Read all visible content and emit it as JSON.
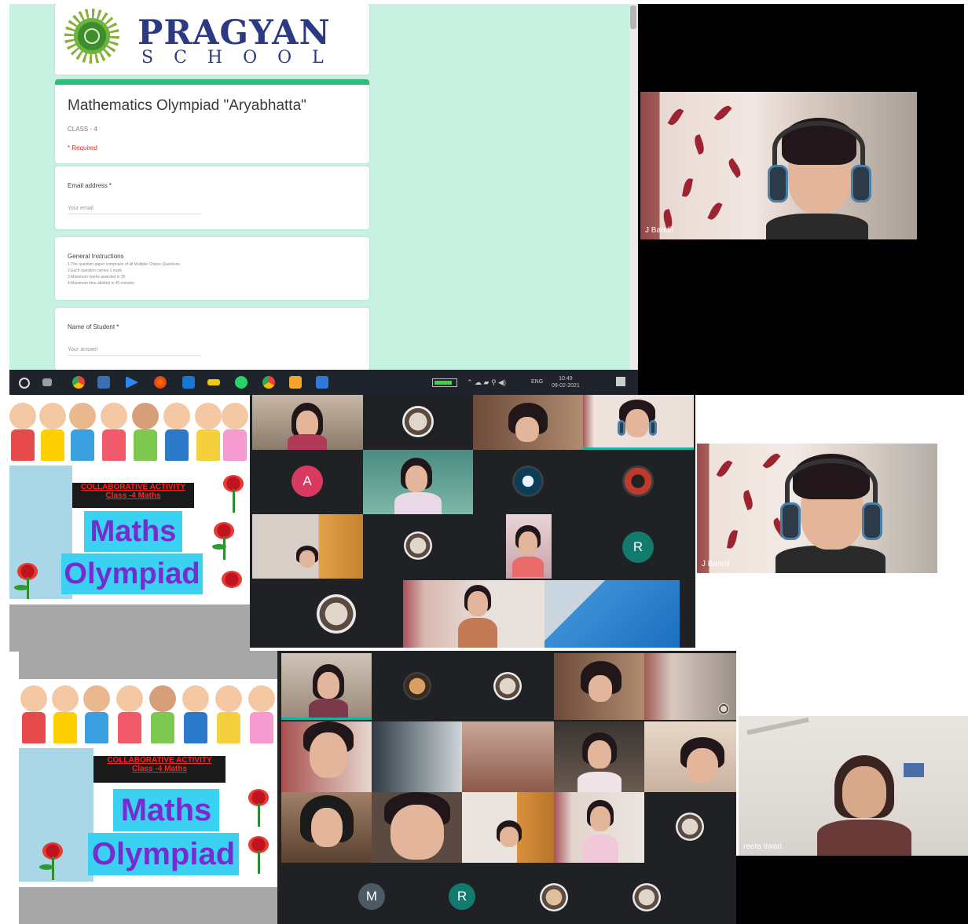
{
  "form": {
    "logo_main": "PRAGYAN",
    "logo_sub": "SCHOOL",
    "title": "Mathematics Olympiad \"Aryabhatta\"",
    "class_label": "CLASS - 4",
    "required_note": "* Required",
    "questions": [
      {
        "label": "Email address *",
        "placeholder": "Your email"
      },
      {
        "label": "Name of Student *",
        "placeholder": "Your answer"
      }
    ],
    "instructions_title": "General Instructions",
    "instructions": [
      "1.The question paper comprises of all Multiple Choice Questions",
      "2.Each question carries 1 mark",
      "3.Maximum marks awarded is 35",
      "4.Maximum time allotted is 45 minutes"
    ]
  },
  "taskbar": {
    "tray_time": "10:49",
    "tray_date": "09-02-2021",
    "tray_lang": "ENG"
  },
  "poster": {
    "collab_line1": "COLLABORATIVE ACTIVITY",
    "collab_line2": "Class -4    Maths",
    "title_line1": "Maths",
    "title_line2": "Olympiad"
  },
  "participants": {
    "top_video_name": "J Bandil",
    "mid_video_name": "J Bandil",
    "teacher_name": "reeta tiwari",
    "avatar_a": "A",
    "avatar_r": "R",
    "avatar_m": "M",
    "avatar_r2": "R"
  },
  "colors": {
    "form_bg": "#c7f1e0",
    "form_accent": "#2bc07a",
    "brand": "#2c3a82",
    "meet_bg": "#202124",
    "avatar_a": "#d93a62",
    "avatar_r": "#127b6e",
    "avatar_m": "#4b5a63",
    "maths_text": "#7a2bd0",
    "maths_bg": "#3ad1f3"
  }
}
